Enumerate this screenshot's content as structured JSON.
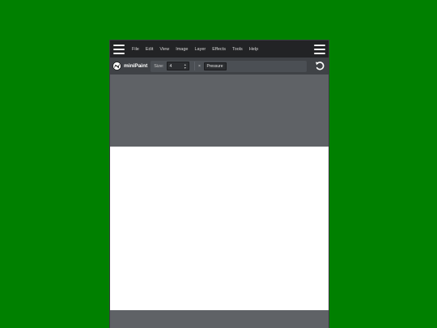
{
  "menu": {
    "items": [
      {
        "label": "File"
      },
      {
        "label": "Edit"
      },
      {
        "label": "View"
      },
      {
        "label": "Image"
      },
      {
        "label": "Layer"
      },
      {
        "label": "Effects"
      },
      {
        "label": "Tools"
      },
      {
        "label": "Help"
      }
    ]
  },
  "toolbar": {
    "logo_text": "miniPaint",
    "size_label": "Size:",
    "size_value": "4",
    "pressure_toggle": "×",
    "pressure_label": "Pressure"
  },
  "icons": {
    "menu_left": "hamburger-icon",
    "menu_right": "hamburger-icon",
    "logo": "minipaint-logo-icon",
    "undo": "undo-icon",
    "spinner_up": "▲",
    "spinner_down": "▼"
  },
  "colors": {
    "page_background": "#008000",
    "menubar": "#222325",
    "toolbar": "#3f4246",
    "workspace": "#5f6266",
    "canvas": "#ffffff"
  }
}
